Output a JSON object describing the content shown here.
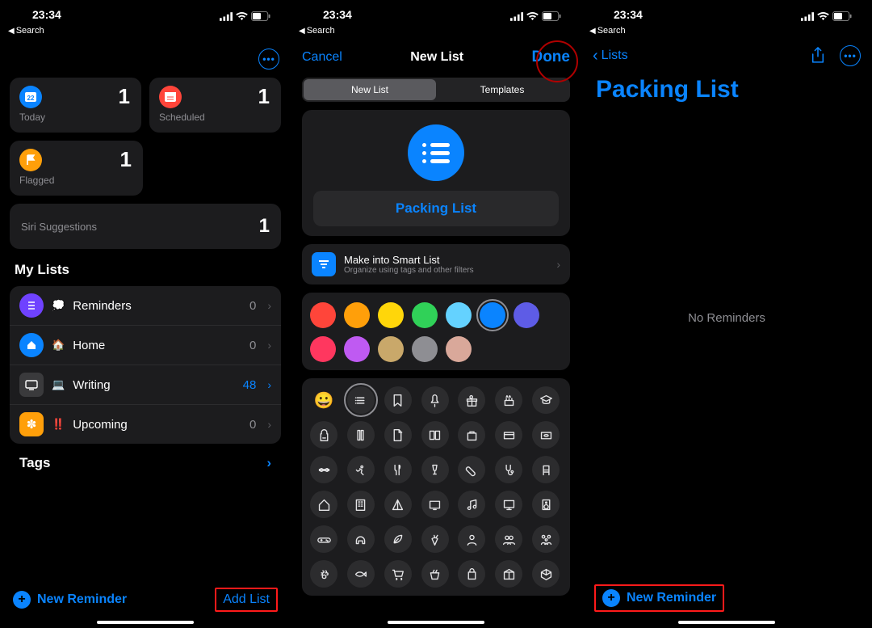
{
  "status": {
    "time": "23:34",
    "back_label": "Search"
  },
  "screen1": {
    "cards": {
      "today": {
        "label": "Today",
        "count": "1",
        "bg": "#0a84ff"
      },
      "scheduled": {
        "label": "Scheduled",
        "count": "1",
        "bg": "#ff453a"
      },
      "flagged": {
        "label": "Flagged",
        "count": "1",
        "bg": "#ff9f0a"
      }
    },
    "siri": {
      "label": "Siri Suggestions",
      "count": "1"
    },
    "my_lists_title": "My Lists",
    "lists": [
      {
        "emoji": "💭",
        "name": "Reminders",
        "count": "0",
        "icon_bg": "#6f42ff",
        "chev": "#5a5a5e"
      },
      {
        "emoji": "🏠",
        "name": "Home",
        "count": "0",
        "icon_bg": "#0a84ff",
        "chev": "#5a5a5e"
      },
      {
        "emoji": "💻",
        "name": "Writing",
        "count": "48",
        "icon_bg": "#3a3a3c",
        "chev": "#0a84ff"
      },
      {
        "emoji": "‼️",
        "name": "Upcoming",
        "count": "0",
        "icon_bg": "#ff9f0a",
        "chev": "#5a5a5e"
      }
    ],
    "tags_title": "Tags",
    "new_reminder": "New Reminder",
    "add_list": "Add List"
  },
  "screen2": {
    "cancel": "Cancel",
    "title": "New List",
    "done": "Done",
    "seg_new": "New List",
    "seg_tpl": "Templates",
    "list_name": "Packing List",
    "smart_title": "Make into Smart List",
    "smart_sub": "Organize using tags and other filters",
    "colors": [
      {
        "hex": "#ff453a"
      },
      {
        "hex": "#ff9f0a"
      },
      {
        "hex": "#ffd60a"
      },
      {
        "hex": "#30d158"
      },
      {
        "hex": "#64d2ff"
      },
      {
        "hex": "#0a84ff",
        "selected": true
      },
      {
        "hex": "#5e5ce6"
      },
      {
        "hex": "#ff375f"
      },
      {
        "hex": "#bf5af2"
      },
      {
        "hex": "#c9a86a"
      },
      {
        "hex": "#8e8e93"
      },
      {
        "hex": "#d9a89a"
      }
    ],
    "icons_grid": [
      "emoji",
      "list-sel",
      "bookmark",
      "pin",
      "gift",
      "cake",
      "graduation",
      "backpack",
      "ruler",
      "doc",
      "book",
      "briefcase",
      "card",
      "money",
      "dumbbell",
      "run",
      "fork",
      "wine",
      "pill",
      "stetho",
      "chair",
      "house",
      "building",
      "tent",
      "tv",
      "music",
      "monitor",
      "speaker",
      "gamepad",
      "headphones",
      "leaf",
      "carrot",
      "person",
      "people",
      "family",
      "paw",
      "fish",
      "cart",
      "basket",
      "bag",
      "box",
      "cube"
    ]
  },
  "screen3": {
    "back": "Lists",
    "title": "Packing List",
    "empty": "No Reminders",
    "new_reminder": "New Reminder"
  }
}
